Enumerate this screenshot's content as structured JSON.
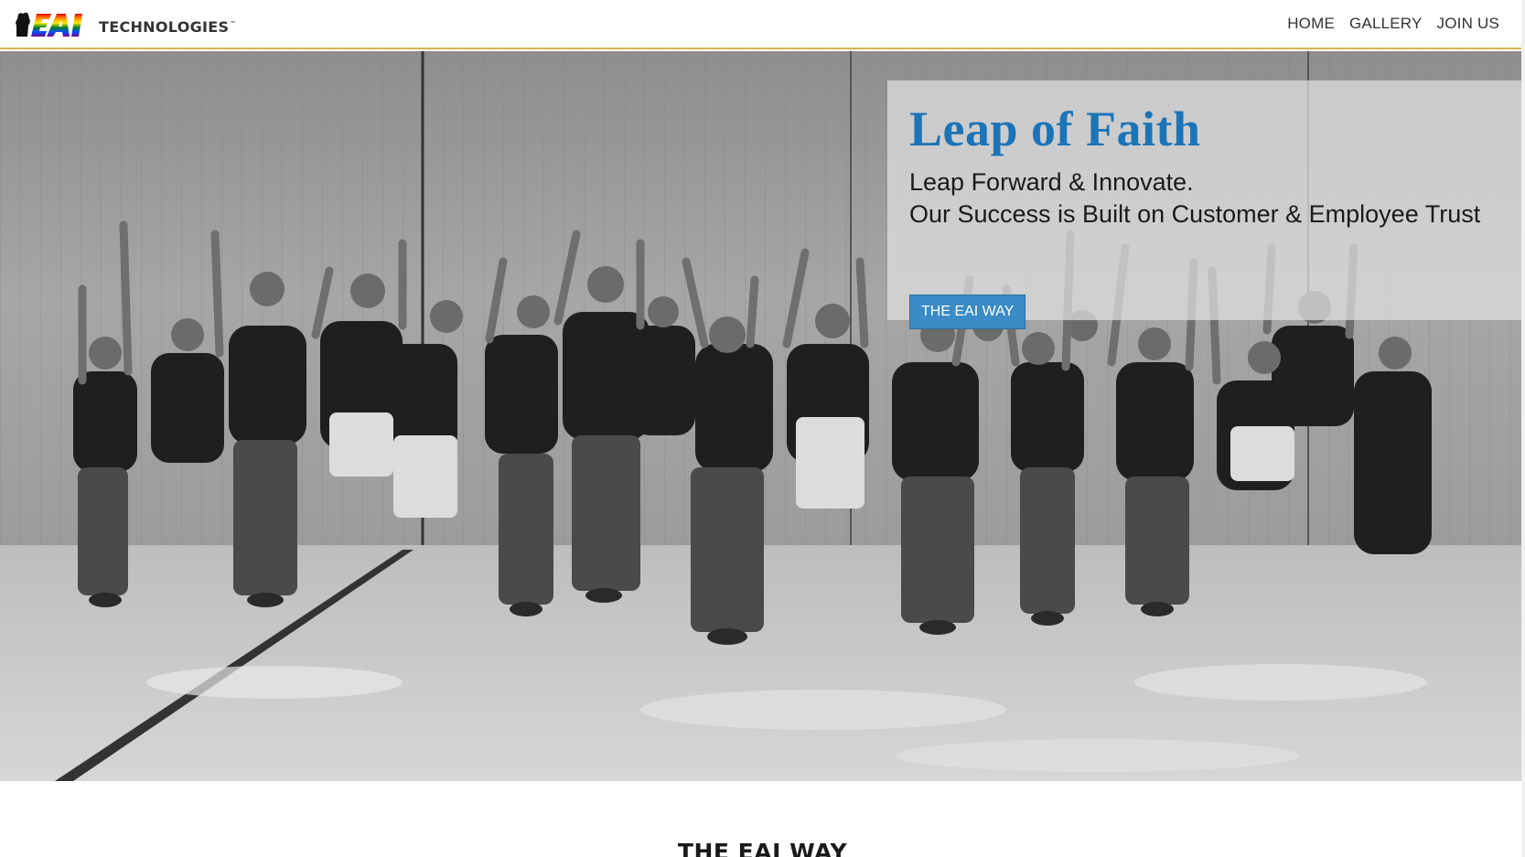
{
  "header": {
    "logo_text": "TECHNOLOGIES",
    "logo_tm": "™",
    "nav": [
      {
        "label": "HOME"
      },
      {
        "label": "GALLERY"
      },
      {
        "label": "JOIN US"
      }
    ]
  },
  "hero": {
    "title": "Leap of Faith",
    "line1": "Leap Forward & Innovate.",
    "line2": "Our Success is Built on Customer & Employee Trust",
    "button_label": "THE EAI WAY",
    "image_icon": "team-photo-image"
  },
  "section": {
    "heading": "THE EAI WAY"
  },
  "colors": {
    "title_blue": "#1b74b8",
    "button_blue": "#3a8bc6",
    "header_border": "#d4b64a"
  }
}
